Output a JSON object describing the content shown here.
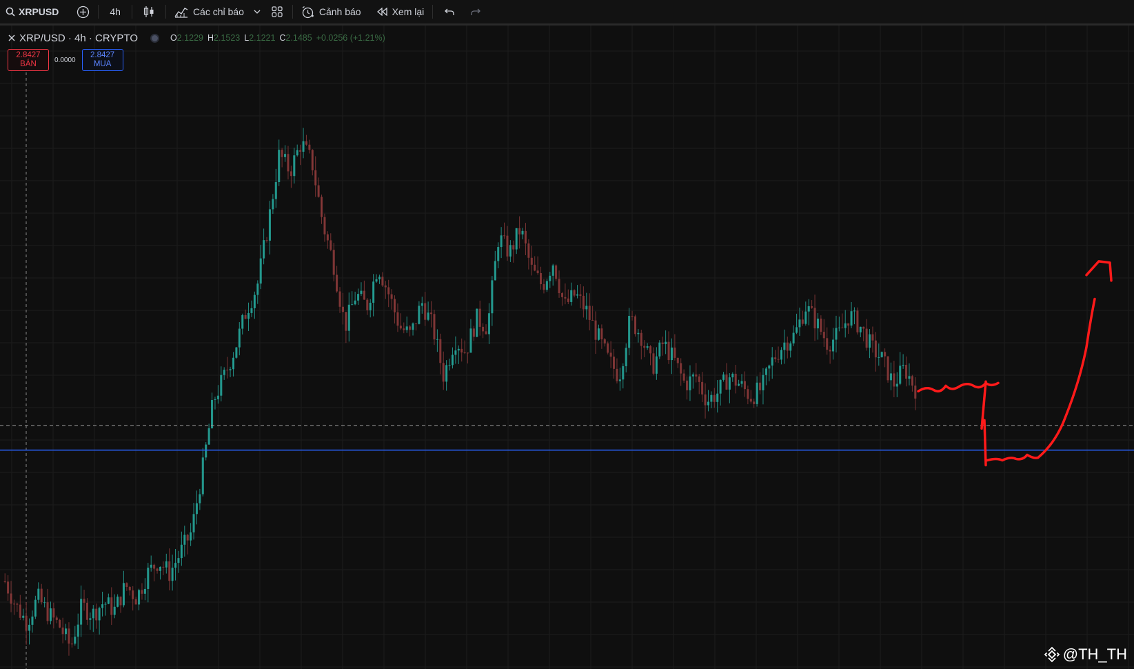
{
  "toolbar": {
    "symbol": "XRPUSD",
    "interval": "4h",
    "indicators_label": "Các chỉ báo",
    "alerts_label": "Cảnh báo",
    "replay_label": "Xem lại"
  },
  "legend": {
    "title": "XRP/USD · 4h · CRYPTO",
    "o_key": "O",
    "o_val": "2.1229",
    "h_key": "H",
    "h_val": "2.1523",
    "l_key": "L",
    "l_val": "2.1221",
    "c_key": "C",
    "c_val": "2.1485",
    "change": "+0.0256 (+1.21%)"
  },
  "trade": {
    "sell_price": "2.8427",
    "sell_label": "BÁN",
    "spread": "0.0000",
    "buy_price": "2.8427",
    "buy_label": "MUA"
  },
  "watermark": "@TH_TH",
  "colors": {
    "background": "#0f0f0f",
    "grid": "#1c1c1c",
    "up_candle": "#26a69a",
    "down_candle": "#8b3a3a",
    "support_line": "#2962ff",
    "drawing": "#ff1a1a",
    "sell": "#f23645",
    "buy": "#2962ff"
  },
  "chart_data": {
    "type": "candlestick",
    "symbol": "XRP/USD",
    "timeframe": "4h",
    "price_path": [
      1.68,
      1.62,
      1.58,
      1.64,
      1.6,
      1.57,
      1.52,
      1.62,
      1.6,
      1.63,
      1.61,
      1.67,
      1.64,
      1.7,
      1.73,
      1.7,
      1.75,
      1.8,
      1.95,
      2.12,
      2.18,
      2.25,
      2.34,
      2.4,
      2.55,
      2.72,
      2.68,
      2.75,
      2.7,
      2.55,
      2.45,
      2.3,
      2.38,
      2.35,
      2.45,
      2.38,
      2.3,
      2.28,
      2.36,
      2.3,
      2.18,
      2.27,
      2.24,
      2.32,
      2.3,
      2.52,
      2.48,
      2.54,
      2.44,
      2.4,
      2.46,
      2.35,
      2.38,
      2.34,
      2.28,
      2.22,
      2.18,
      2.32,
      2.28,
      2.2,
      2.26,
      2.22,
      2.16,
      2.18,
      2.12,
      2.14,
      2.18,
      2.16,
      2.13,
      2.15,
      2.22,
      2.26,
      2.28,
      2.35,
      2.31,
      2.26,
      2.28,
      2.33,
      2.3,
      2.25,
      2.22,
      2.16,
      2.2,
      2.15
    ],
    "horizontal_line": 2.0,
    "dashed_line": 2.06,
    "drawn_projection": "sideways then drop to support, then sharp rise (arrow up)"
  }
}
